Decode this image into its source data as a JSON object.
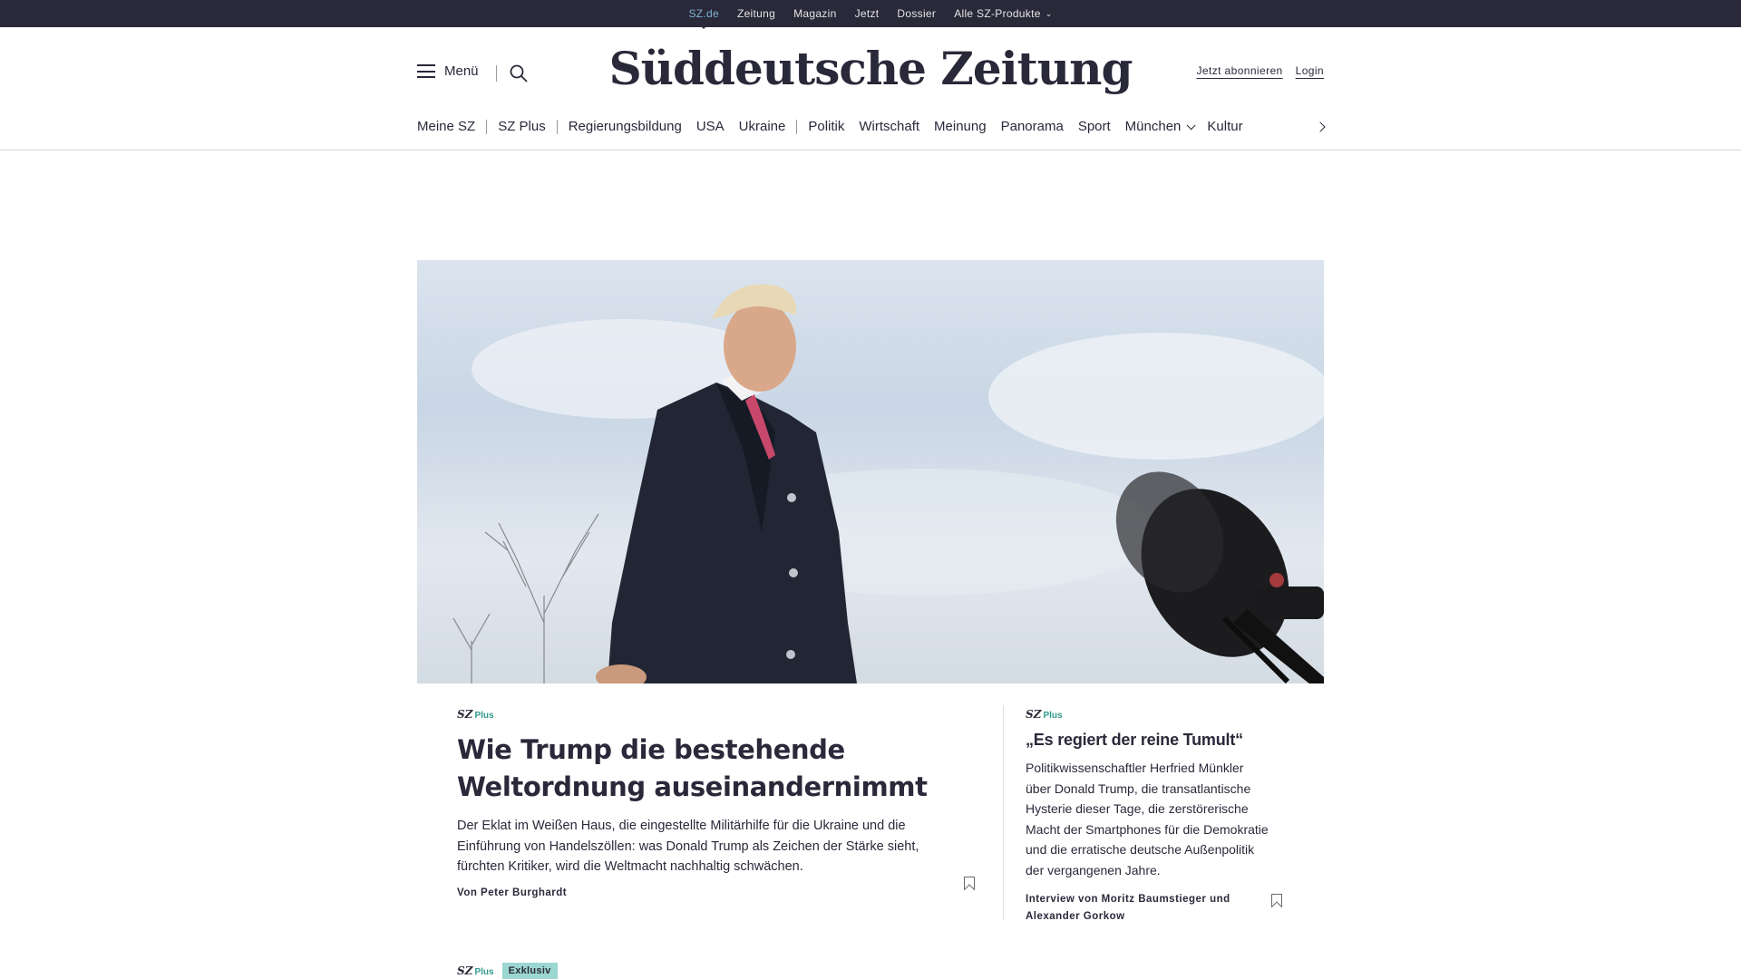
{
  "topbar": {
    "items": [
      {
        "label": "SZ.de",
        "active": true
      },
      {
        "label": "Zeitung"
      },
      {
        "label": "Magazin"
      },
      {
        "label": "Jetzt"
      },
      {
        "label": "Dossier"
      },
      {
        "label": "Alle SZ-Produkte",
        "dropdown": true
      }
    ]
  },
  "header": {
    "menu_label": "Menü",
    "logo": "Süddeutsche Zeitung",
    "subscribe": "Jetzt abonnieren",
    "login": "Login"
  },
  "nav": {
    "items": [
      "Meine SZ",
      "SZ Plus",
      "Regierungsbildung",
      "USA",
      "Ukraine",
      "Politik",
      "Wirtschaft",
      "Meinung",
      "Panorama",
      "Sport",
      "München",
      "Kultur"
    ]
  },
  "hero": {
    "image_alt": "Donald Trump spricht vor Mikrofonen"
  },
  "lead": {
    "plus_sz": "SZ",
    "plus_label": "Plus",
    "headline": "Wie Trump die bestehende Weltordnung auseinandernimmt",
    "teaser": "Der Eklat im Weißen Haus, die eingestellte Militärhilfe für die Ukraine und die Einführung von Handelszöllen: was Donald Trump als Zeichen der Stärke sieht, fürchten Kritiker, wird die Weltmacht nachhaltig schwächen.",
    "byline": "Von Peter Burghardt"
  },
  "side": {
    "plus_sz": "SZ",
    "plus_label": "Plus",
    "headline": "„Es regiert der reine Tumult“",
    "teaser": "Politikwissenschaftler Herfried Münkler über Donald Trump, die transatlantische Hysterie dieser Tage, die zerstörerische Macht der Smartphones für die Demokratie und die erratische deutsche Außenpolitik der vergangenen Jahre.",
    "byline": "Interview von Moritz Baumstieger und Alexander Gorkow"
  },
  "next": {
    "plus_sz": "SZ",
    "plus_label": "Plus",
    "badge": "Exklusiv"
  }
}
